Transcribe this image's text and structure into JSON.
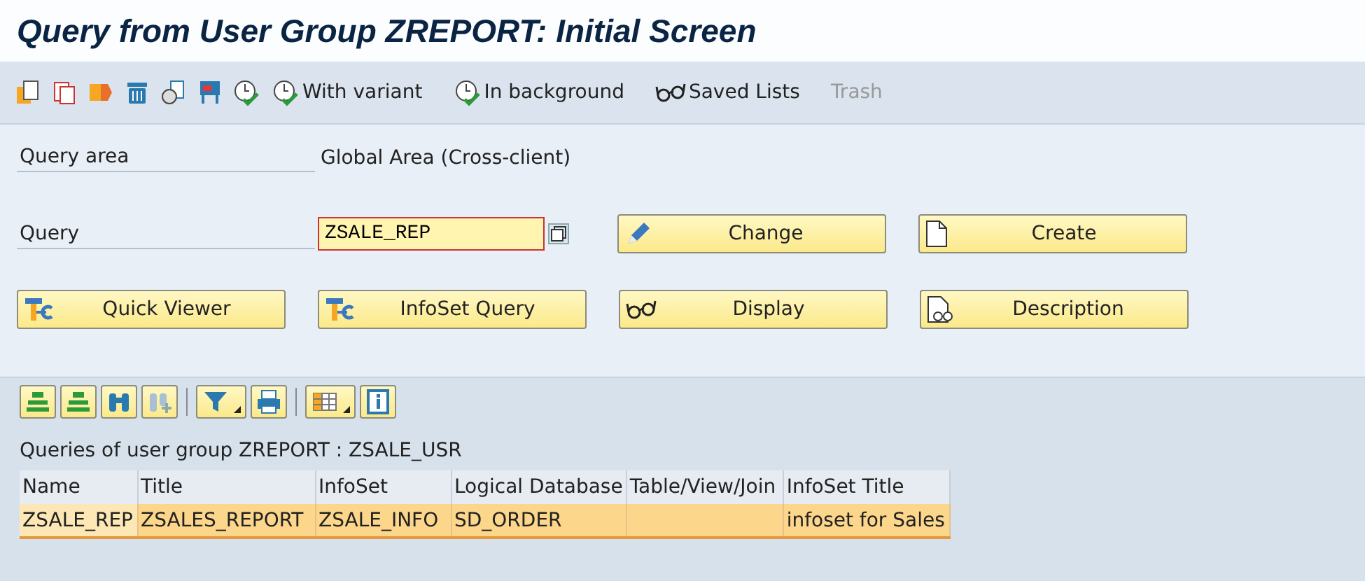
{
  "window": {
    "title": "Query from User Group ZREPORT: Initial Screen"
  },
  "toolbar": {
    "buttons": [
      {
        "label": "With variant",
        "disabled": false
      },
      {
        "label": "In background",
        "disabled": false
      },
      {
        "label": "Saved Lists",
        "disabled": false
      },
      {
        "label": "Trash",
        "disabled": true
      }
    ]
  },
  "form": {
    "query_area": {
      "label": "Query area",
      "value": "Global Area (Cross-client)"
    },
    "query": {
      "label": "Query",
      "value": "ZSALE_REP"
    },
    "buttons": [
      {
        "label": "Change"
      },
      {
        "label": "Create"
      },
      {
        "label": "Quick Viewer"
      },
      {
        "label": "InfoSet Query"
      },
      {
        "label": "Display"
      },
      {
        "label": "Description"
      }
    ]
  },
  "list": {
    "caption": "Queries of user group ZREPORT : ZSALE_USR",
    "table": {
      "columns": [
        "Name",
        "Title",
        "InfoSet",
        "Logical Database",
        "Table/View/Join",
        "InfoSet Title"
      ],
      "rows": [
        {
          "selected": true,
          "cells": [
            "ZSALE_REP",
            "ZSALES_REPORT",
            "ZSALE_INFO",
            "SD_ORDER",
            "",
            "infoset for Sales"
          ]
        }
      ]
    }
  }
}
